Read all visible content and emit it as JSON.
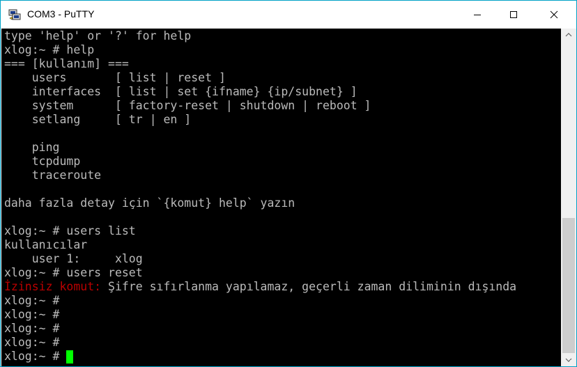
{
  "window": {
    "title": "COM3 - PuTTY",
    "app_icon": "putty-icon",
    "accent_color": "#00a2c7",
    "controls": {
      "minimize_icon": "minimize-icon",
      "maximize_icon": "maximize-icon",
      "close_icon": "close-icon"
    }
  },
  "terminal": {
    "background": "#000000",
    "text_color": "#bbbbbb",
    "error_color": "#bb0000",
    "cursor_color": "#00ff00",
    "lines": [
      {
        "text": "type 'help' or '?' for help"
      },
      {
        "text": "xlog:~ # help"
      },
      {
        "text": "=== [kullanım] ==="
      },
      {
        "text": "    users       [ list | reset ]"
      },
      {
        "text": "    interfaces  [ list | set {ifname} {ip/subnet} ]"
      },
      {
        "text": "    system      [ factory-reset | shutdown | reboot ]"
      },
      {
        "text": "    setlang     [ tr | en ]"
      },
      {
        "text": ""
      },
      {
        "text": "    ping"
      },
      {
        "text": "    tcpdump"
      },
      {
        "text": "    traceroute"
      },
      {
        "text": ""
      },
      {
        "text": "daha fazla detay için `{komut} help` yazın"
      },
      {
        "text": ""
      },
      {
        "text": "xlog:~ # users list"
      },
      {
        "text": "kullanıcılar"
      },
      {
        "text": "    user 1:     xlog"
      },
      {
        "text": "xlog:~ # users reset"
      },
      {
        "error_prefix": "İzinsiz komut:",
        "text": " Şifre sıfırlanma yapılamaz, geçerli zaman diliminin dışında"
      },
      {
        "text": "xlog:~ #"
      },
      {
        "text": "xlog:~ #"
      },
      {
        "text": "xlog:~ #"
      },
      {
        "text": "xlog:~ #"
      }
    ],
    "prompt": "xlog:~ # "
  },
  "scrollbar": {
    "up_icon": "scroll-up-arrow-icon",
    "down_icon": "scroll-down-arrow-icon"
  }
}
